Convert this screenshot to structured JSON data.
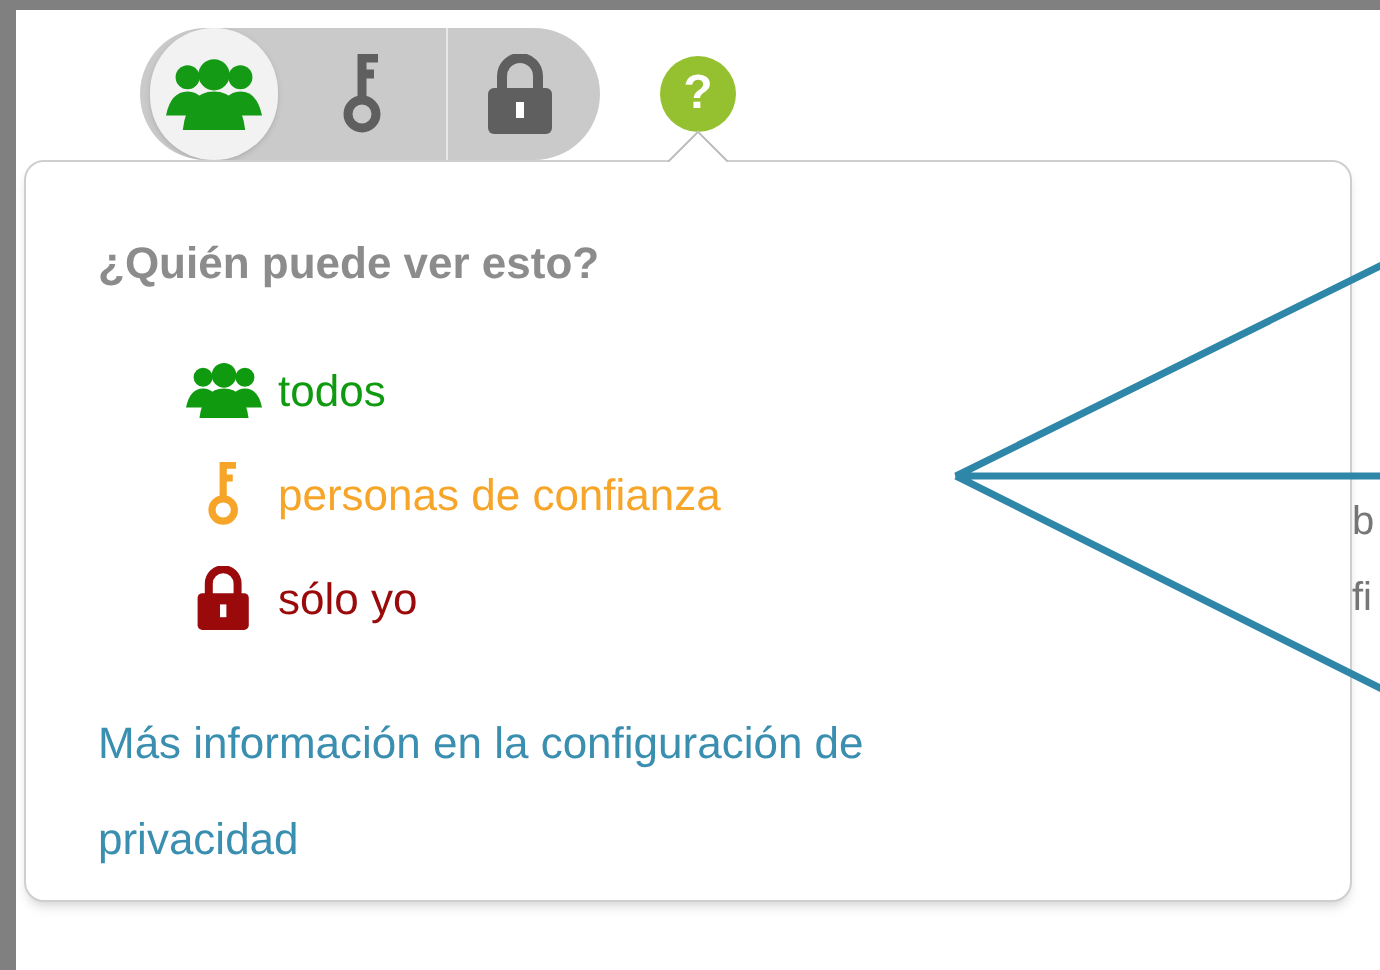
{
  "audience_switch": [
    {
      "kind": "people",
      "selected": true
    },
    {
      "kind": "key",
      "selected": false
    },
    {
      "kind": "lock",
      "selected": false
    }
  ],
  "help_button": {
    "label": "?"
  },
  "popover": {
    "title": "¿Quién puede ver esto?",
    "options": [
      {
        "kind": "people",
        "label": "todos",
        "color": "#109a10"
      },
      {
        "kind": "key",
        "label": "personas de confianza",
        "color": "#f7a528"
      },
      {
        "kind": "lock",
        "label": "sólo yo",
        "color": "#9a0a0a"
      }
    ],
    "link": "Más información en la configuración de privacidad"
  },
  "background_text": [
    "b",
    "fi"
  ]
}
